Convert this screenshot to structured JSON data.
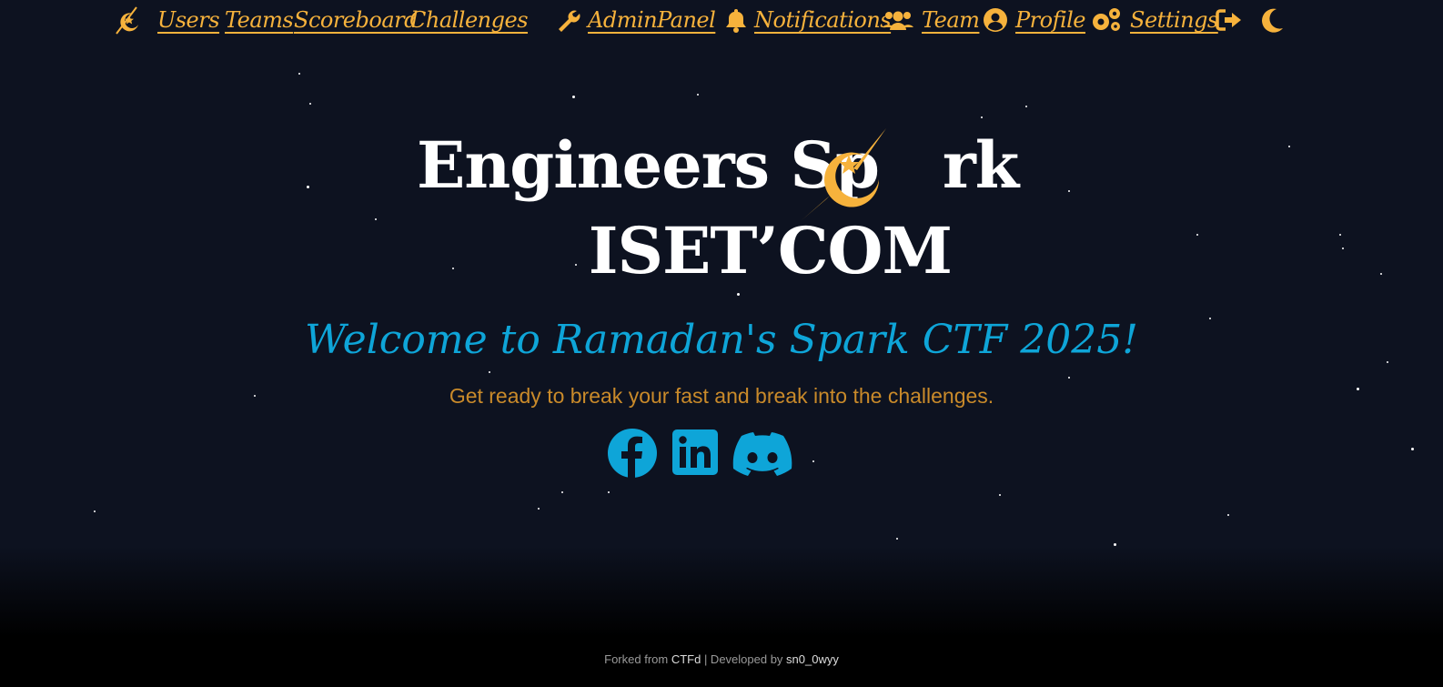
{
  "nav": {
    "users": "Users",
    "teams": "Teams",
    "scoreboard": "Scoreboard",
    "challenges": "Challenges",
    "admin_panel": "AdminPanel",
    "notifications": "Notifications",
    "team": "Team",
    "profile": "Profile",
    "settings": "Settings"
  },
  "brand": {
    "line1_prefix": "Engineers Sp",
    "line1_suffix": "rk",
    "line2": "ISET’COM"
  },
  "welcome": "Welcome to Ramadan's Spark CTF 2025!",
  "tagline": "Get ready to break your fast and break into the challenges.",
  "socials": [
    "facebook-icon",
    "linkedin-icon",
    "discord-icon"
  ],
  "footer": {
    "forked_prefix": "Forked from ",
    "ctfd": "CTFd",
    "separator": " | Developed by ",
    "developer": "sn0_0wyy"
  },
  "colors": {
    "background": "#0d1220",
    "nav_accent": "#f6b23c",
    "welcome": "#0ea5d8",
    "tagline": "#c98a2a",
    "footer_bg": "#000000"
  }
}
